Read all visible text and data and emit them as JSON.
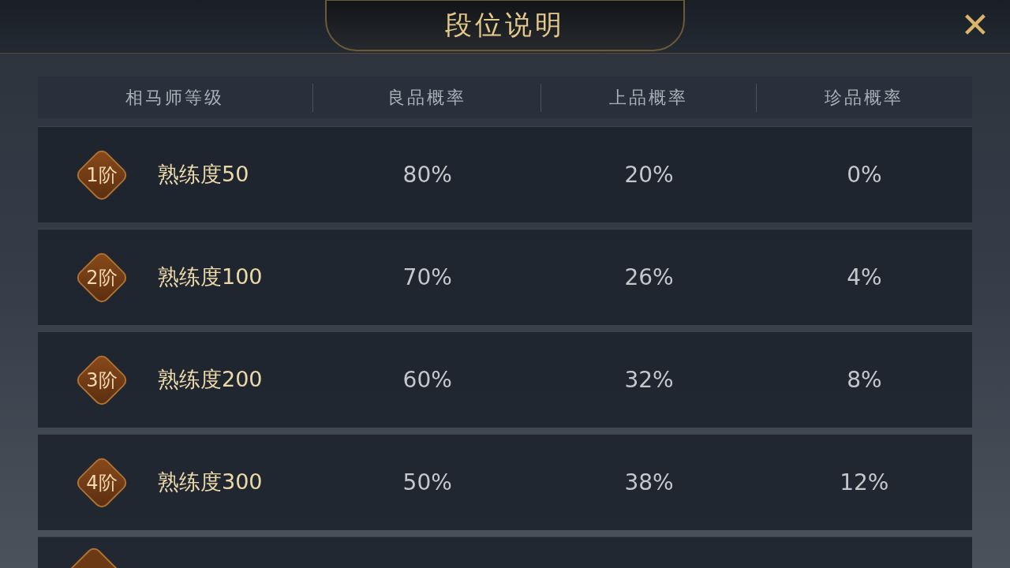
{
  "title": "段位说明",
  "close_button": {
    "label": "✕"
  },
  "columns": [
    "相马师等级",
    "良品概率",
    "上品概率",
    "珍品概率"
  ],
  "rows": [
    {
      "rank": "1阶",
      "proficiency": "熟练度50",
      "values": [
        "80%",
        "20%",
        "0%"
      ]
    },
    {
      "rank": "2阶",
      "proficiency": "熟练度100",
      "values": [
        "70%",
        "26%",
        "4%"
      ]
    },
    {
      "rank": "3阶",
      "proficiency": "熟练度200",
      "values": [
        "60%",
        "32%",
        "8%"
      ]
    },
    {
      "rank": "4阶",
      "proficiency": "熟练度300",
      "values": [
        "50%",
        "38%",
        "12%"
      ]
    }
  ]
}
